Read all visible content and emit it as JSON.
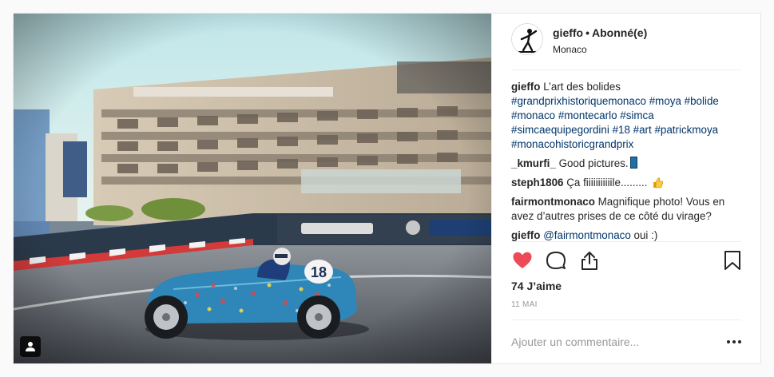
{
  "header": {
    "username": "gieffo",
    "separator": "•",
    "follow_status": "Abonné(e)",
    "location": "Monaco"
  },
  "caption": {
    "username": "gieffo",
    "text": "L’art des bolides",
    "hashtags": [
      "#grandprixhistoriquemonaco",
      "#moya",
      "#bolide",
      "#monaco",
      "#montecarlo",
      "#simca",
      "#simcaequipegordini",
      "#18",
      "#art",
      "#patrickmoya",
      "#monacohistoricgrandprix"
    ]
  },
  "comments": [
    {
      "username": "_kmurfi_",
      "text": "Good pictures.",
      "emoji": "blue-square-emoji"
    },
    {
      "username": "steph1806",
      "text": "Ça fiiiiiiiiiiile.........",
      "emoji": "thumbs-up-emoji"
    },
    {
      "username": "fairmontmonaco",
      "text": "Magnifique photo! Vous en avez d’autres prises de ce côté du virage?"
    },
    {
      "username": "gieffo",
      "mention": "@fairmontmonaco",
      "text": "oui :)"
    }
  ],
  "actions": {
    "like_icon": "heart-icon",
    "comment_icon": "comment-icon",
    "share_icon": "share-icon",
    "save_icon": "bookmark-icon",
    "like_color": "#ed4956"
  },
  "likes": "74 J’aime",
  "date": "11 MAI",
  "add_comment": {
    "placeholder": "Ajouter un commentaire..."
  },
  "car_number": "18"
}
